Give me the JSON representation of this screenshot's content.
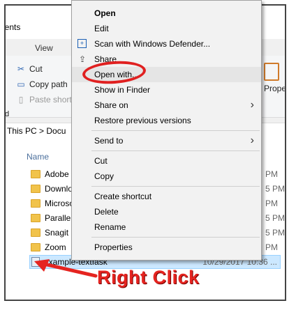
{
  "window": {
    "title_partial": "nents"
  },
  "ribbon": {
    "tabs": [
      {
        "label": "View"
      }
    ],
    "clipboard": {
      "cut": "Cut",
      "copy_path": "Copy path",
      "paste_shortcut": "Paste shortc"
    },
    "properties_partial": "Prope",
    "left_partial_label": "d"
  },
  "address": {
    "path": "This PC  >  Docu"
  },
  "files": {
    "column_name": "Name",
    "rows": [
      {
        "name": "Adobe",
        "type": "folder",
        "date": "PM"
      },
      {
        "name": "Downlo",
        "type": "folder",
        "date": "5 PM"
      },
      {
        "name": "Microso",
        "type": "folder",
        "date": "PM"
      },
      {
        "name": "Parallels",
        "type": "folder",
        "date": "5 PM"
      },
      {
        "name": "Snagit",
        "type": "folder",
        "date": "5 PM"
      },
      {
        "name": "Zoom",
        "type": "folder",
        "date": "PM"
      },
      {
        "name": "example-textfask",
        "type": "text",
        "date": "10/29/2017 10:36 ..."
      }
    ]
  },
  "context_menu": {
    "items": [
      {
        "label": "Open",
        "bold": true
      },
      {
        "label": "Edit"
      },
      {
        "label": "Scan with Windows Defender...",
        "icon": "defender-icon"
      },
      {
        "label": "Share",
        "icon": "share-icon"
      },
      {
        "label": "Open with...",
        "highlighted": true
      },
      {
        "label": "Show in Finder"
      },
      {
        "label": "Share on",
        "submenu": true
      },
      {
        "label": "Restore previous versions"
      },
      {
        "label": "Send to",
        "submenu": true
      },
      {
        "label": "Cut"
      },
      {
        "label": "Copy"
      },
      {
        "label": "Create shortcut"
      },
      {
        "label": "Delete"
      },
      {
        "label": "Rename"
      },
      {
        "label": "Properties"
      }
    ]
  },
  "annotation": {
    "callout_text": "Right Click",
    "color": "#e52420"
  }
}
